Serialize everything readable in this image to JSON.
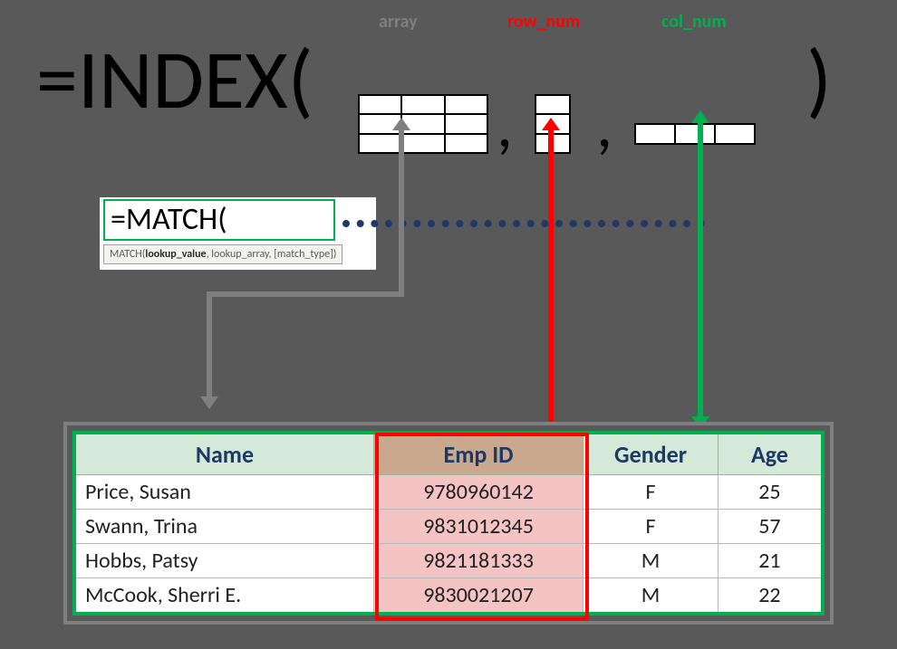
{
  "labels": {
    "array": "array",
    "row_num": "row_num",
    "col_num": "col_num"
  },
  "formula": {
    "prefix": "=INDEX(",
    "comma": ",",
    "close": ")"
  },
  "match": {
    "text": "=MATCH(",
    "tooltip_a": "MATCH(",
    "tooltip_b": "lookup_value",
    "tooltip_c": ", lookup_array, [match_type])"
  },
  "table": {
    "headers": {
      "name": "Name",
      "emp": "Emp ID",
      "gender": "Gender",
      "age": "Age"
    },
    "rows": [
      {
        "name": "Price, Susan",
        "emp": "9780960142",
        "gender": "F",
        "age": "25"
      },
      {
        "name": "Swann, Trina",
        "emp": "9831012345",
        "gender": "F",
        "age": "57"
      },
      {
        "name": "Hobbs, Patsy",
        "emp": "9821181333",
        "gender": "M",
        "age": "21"
      },
      {
        "name": "McCook, Sherri E.",
        "emp": "9830021207",
        "gender": "M",
        "age": "22"
      }
    ]
  }
}
